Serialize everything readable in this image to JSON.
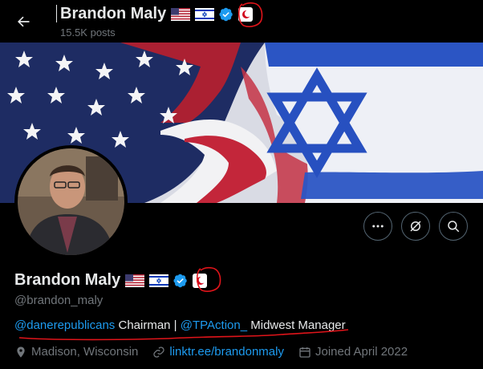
{
  "header": {
    "name": "Brandon Maly",
    "posts": "15.5K posts"
  },
  "profile": {
    "name": "Brandon Maly",
    "handle": "@brandon_maly",
    "bio": {
      "mention1": "@danerepublicans",
      "text1": " Chairman | ",
      "mention2": "@TPAction_",
      "text2": " Midwest Manager"
    },
    "location": "Madison, Wisconsin",
    "website": "linktr.ee/brandonmaly",
    "joined": "Joined April 2022"
  },
  "icons": {
    "back": "arrow-left-icon",
    "more": "more-icon",
    "grok": "grok-icon",
    "search": "search-icon",
    "verified": "verified-badge-icon",
    "location": "location-icon",
    "link": "link-icon",
    "calendar": "calendar-icon"
  },
  "colors": {
    "accent": "#1d9bf0",
    "annotation": "#e0141a"
  }
}
